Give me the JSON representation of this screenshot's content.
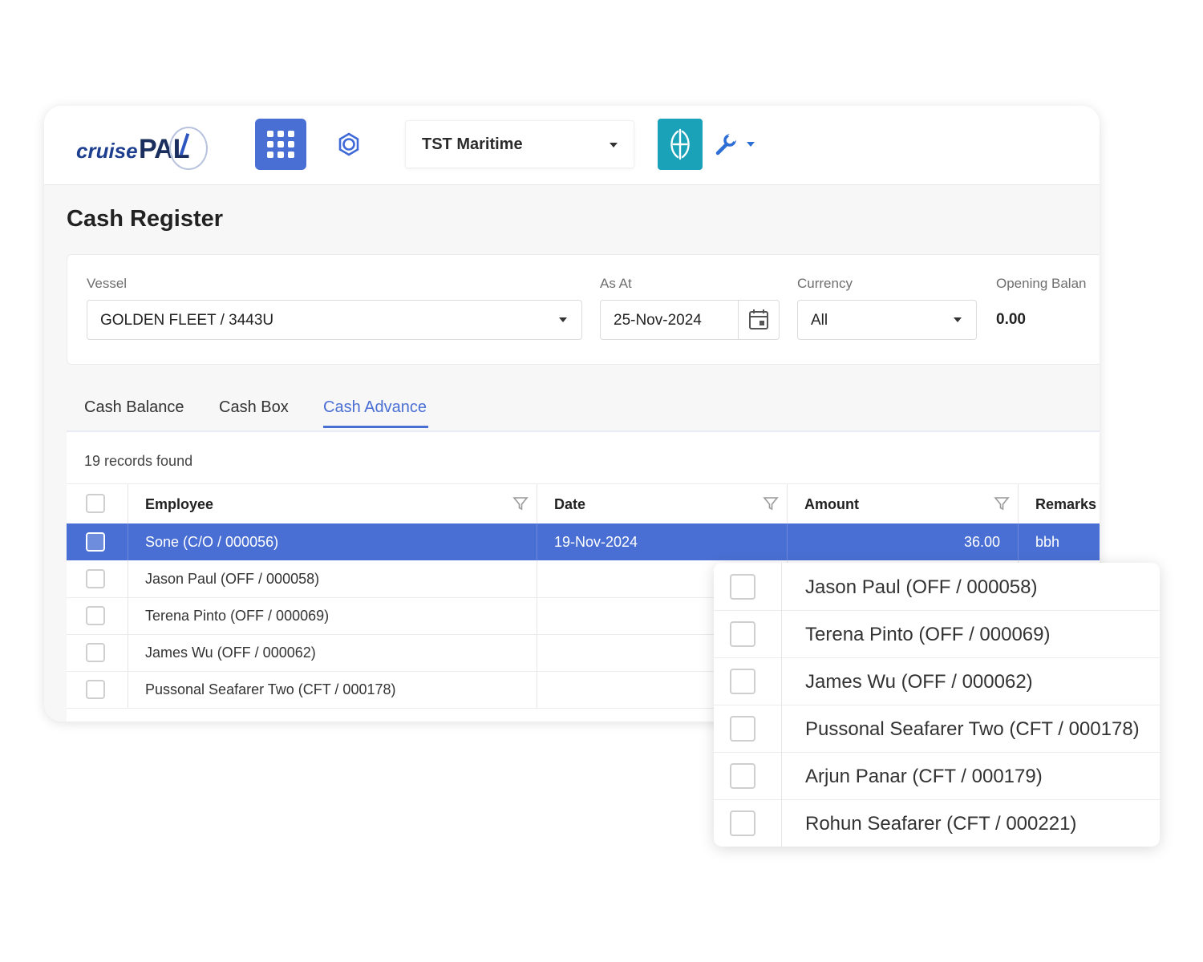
{
  "app": {
    "logo_text_a": "cruise",
    "logo_text_b": "PAL",
    "company": "TST Maritime",
    "accent": "#4a6fd4",
    "brand_tile_color": "#1aa3b8",
    "icons": [
      "apps-grid-icon",
      "settings-gear-icon",
      "brand-logo-icon",
      "wrench-icon",
      "chevron-down-icon"
    ]
  },
  "page": {
    "title": "Cash Register"
  },
  "filters": {
    "vessel": {
      "label": "Vessel",
      "value": "GOLDEN FLEET / 3443U"
    },
    "as_at": {
      "label": "As At",
      "value": "25-Nov-2024"
    },
    "currency": {
      "label": "Currency",
      "value": "All"
    },
    "opening_balance": {
      "label": "Opening Balan",
      "value": "0.00"
    }
  },
  "tabs": [
    {
      "label": "Cash Balance",
      "active": false
    },
    {
      "label": "Cash Box",
      "active": false
    },
    {
      "label": "Cash Advance",
      "active": true
    }
  ],
  "grid": {
    "records_text": "19 records found",
    "columns": [
      "Employee",
      "Date",
      "Amount",
      "Remarks"
    ],
    "rows": [
      {
        "employee": "Sone (C/O / 000056)",
        "date": "19-Nov-2024",
        "amount": "36.00",
        "remarks": "bbh",
        "selected": true
      },
      {
        "employee": "Jason Paul (OFF / 000058)",
        "date": "",
        "amount": "",
        "remarks": "",
        "selected": false
      },
      {
        "employee": "Terena Pinto (OFF / 000069)",
        "date": "",
        "amount": "",
        "remarks": "",
        "selected": false
      },
      {
        "employee": "James Wu (OFF / 000062)",
        "date": "",
        "amount": "",
        "remarks": "",
        "selected": false
      },
      {
        "employee": "Pussonal Seafarer Two (CFT / 000178)",
        "date": "",
        "amount": "",
        "remarks": "",
        "selected": false
      }
    ]
  },
  "zoom": {
    "rows": [
      "Jason Paul (OFF / 000058)",
      "Terena Pinto (OFF / 000069)",
      "James Wu (OFF / 000062)",
      "Pussonal Seafarer Two (CFT / 000178)",
      "Arjun Panar (CFT / 000179)",
      "Rohun Seafarer (CFT / 000221)"
    ]
  }
}
